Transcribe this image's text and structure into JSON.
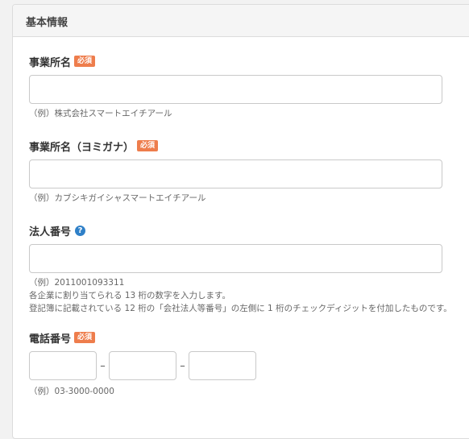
{
  "section": {
    "title": "基本情報"
  },
  "required_badge": "必須",
  "fields": {
    "office_name": {
      "label": "事業所名",
      "value": "",
      "hint": "（例）株式会社スマートエイチアール"
    },
    "office_name_kana": {
      "label": "事業所名（ヨミガナ）",
      "value": "",
      "hint": "（例）カブシキガイシャスマートエイチアール"
    },
    "corporate_number": {
      "label": "法人番号",
      "help_icon": "question-circle-icon",
      "value": "",
      "hint_lines": [
        "（例）2011001093311",
        "各企業に割り当てられる 13 桁の数字を入力します。",
        "登記簿に記載されている 12 桁の「会社法人等番号」の左側に 1 桁のチェックディジットを付加したものです。"
      ]
    },
    "phone": {
      "label": "電話番号",
      "separator": "–",
      "parts": [
        "",
        "",
        ""
      ],
      "hint": "（例）03-3000-0000"
    }
  },
  "colors": {
    "badge": "#ee7d4c",
    "help_icon": "#2f80c8",
    "border": "#c9c9c9",
    "header_bg": "#f5f5f5"
  }
}
